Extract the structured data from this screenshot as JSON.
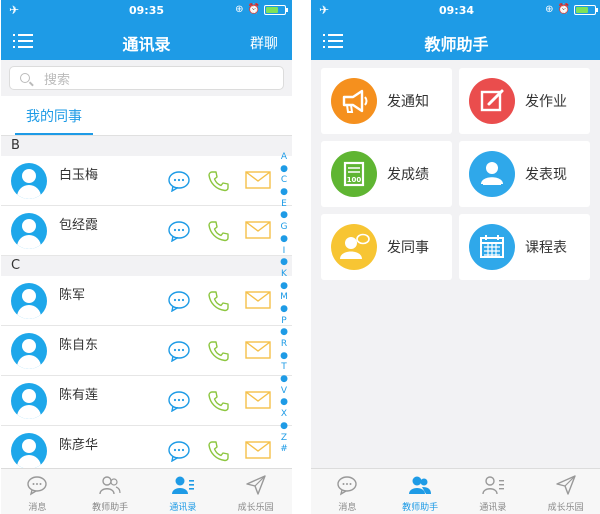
{
  "left": {
    "status": {
      "time": "09:35"
    },
    "nav": {
      "title": "通讯录",
      "action": "群聊"
    },
    "search": {
      "placeholder": "搜索"
    },
    "tab": {
      "label": "我的同事"
    },
    "sections": [
      {
        "letter": "B",
        "contacts": [
          {
            "name": "白玉梅"
          },
          {
            "name": "包经霞"
          }
        ]
      },
      {
        "letter": "C",
        "contacts": [
          {
            "name": "陈军"
          },
          {
            "name": "陈自东"
          },
          {
            "name": "陈有莲"
          },
          {
            "name": "陈彦华"
          }
        ]
      }
    ],
    "index": [
      "A",
      "●",
      "C",
      "●",
      "E",
      "●",
      "G",
      "●",
      "I",
      "●",
      "K",
      "●",
      "M",
      "●",
      "P",
      "●",
      "R",
      "●",
      "T",
      "●",
      "V",
      "●",
      "X",
      "●",
      "Z",
      "#"
    ]
  },
  "right": {
    "status": {
      "time": "09:34"
    },
    "nav": {
      "title": "教师助手"
    },
    "tiles": [
      {
        "label": "发通知",
        "icon": "megaphone-icon",
        "color": "#f5901e"
      },
      {
        "label": "发作业",
        "icon": "edit-icon",
        "color": "#ea4d4d"
      },
      {
        "label": "发成绩",
        "icon": "score-icon",
        "color": "#5fb532"
      },
      {
        "label": "发表现",
        "icon": "performance-icon",
        "color": "#2fa8ea"
      },
      {
        "label": "发同事",
        "icon": "colleague-icon",
        "color": "#f7c533"
      },
      {
        "label": "课程表",
        "icon": "calendar-icon",
        "color": "#2fa8ea"
      }
    ]
  },
  "bottom_tabs": [
    {
      "label": "消息",
      "icon": "message-icon"
    },
    {
      "label": "教师助手",
      "icon": "teacher-assistant-icon"
    },
    {
      "label": "通讯录",
      "icon": "contacts-icon"
    },
    {
      "label": "成长乐园",
      "icon": "paper-plane-icon"
    }
  ],
  "colors": {
    "primary": "#1e9be6",
    "background": "#f2f2f4",
    "chat_icon": "#1e9be6",
    "phone_icon": "#8cc63f",
    "mail_icon": "#f5c04a"
  }
}
